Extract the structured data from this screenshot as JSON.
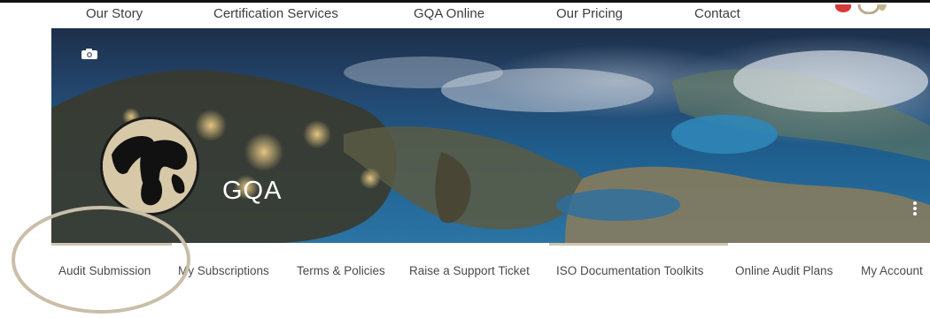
{
  "top_nav": {
    "items": [
      {
        "label": "Our Story"
      },
      {
        "label": "Certification Services"
      },
      {
        "label": "GQA Online"
      },
      {
        "label": "Our Pricing"
      },
      {
        "label": "Contact"
      }
    ]
  },
  "hero": {
    "camera_icon": "camera-icon",
    "avatar_icon": "globe-icon",
    "profile_name": "GQA",
    "more_icon": "more-vertical-icon"
  },
  "tabs": {
    "items": [
      {
        "label": "Audit Submission",
        "active": true
      },
      {
        "label": "My Subscriptions",
        "active": false
      },
      {
        "label": "Terms & Policies",
        "active": false
      },
      {
        "label": "Raise a Support Ticket",
        "active": false
      },
      {
        "label": "ISO Documentation Toolkits",
        "active": true
      },
      {
        "label": "Online Audit Plans",
        "active": false
      },
      {
        "label": "My Account",
        "active": false
      }
    ]
  },
  "colors": {
    "nav_text": "#3d3d3d",
    "tab_text": "#4a4a4a",
    "accent_tan": "#cfc5b2",
    "ring": "#c9bea8"
  }
}
